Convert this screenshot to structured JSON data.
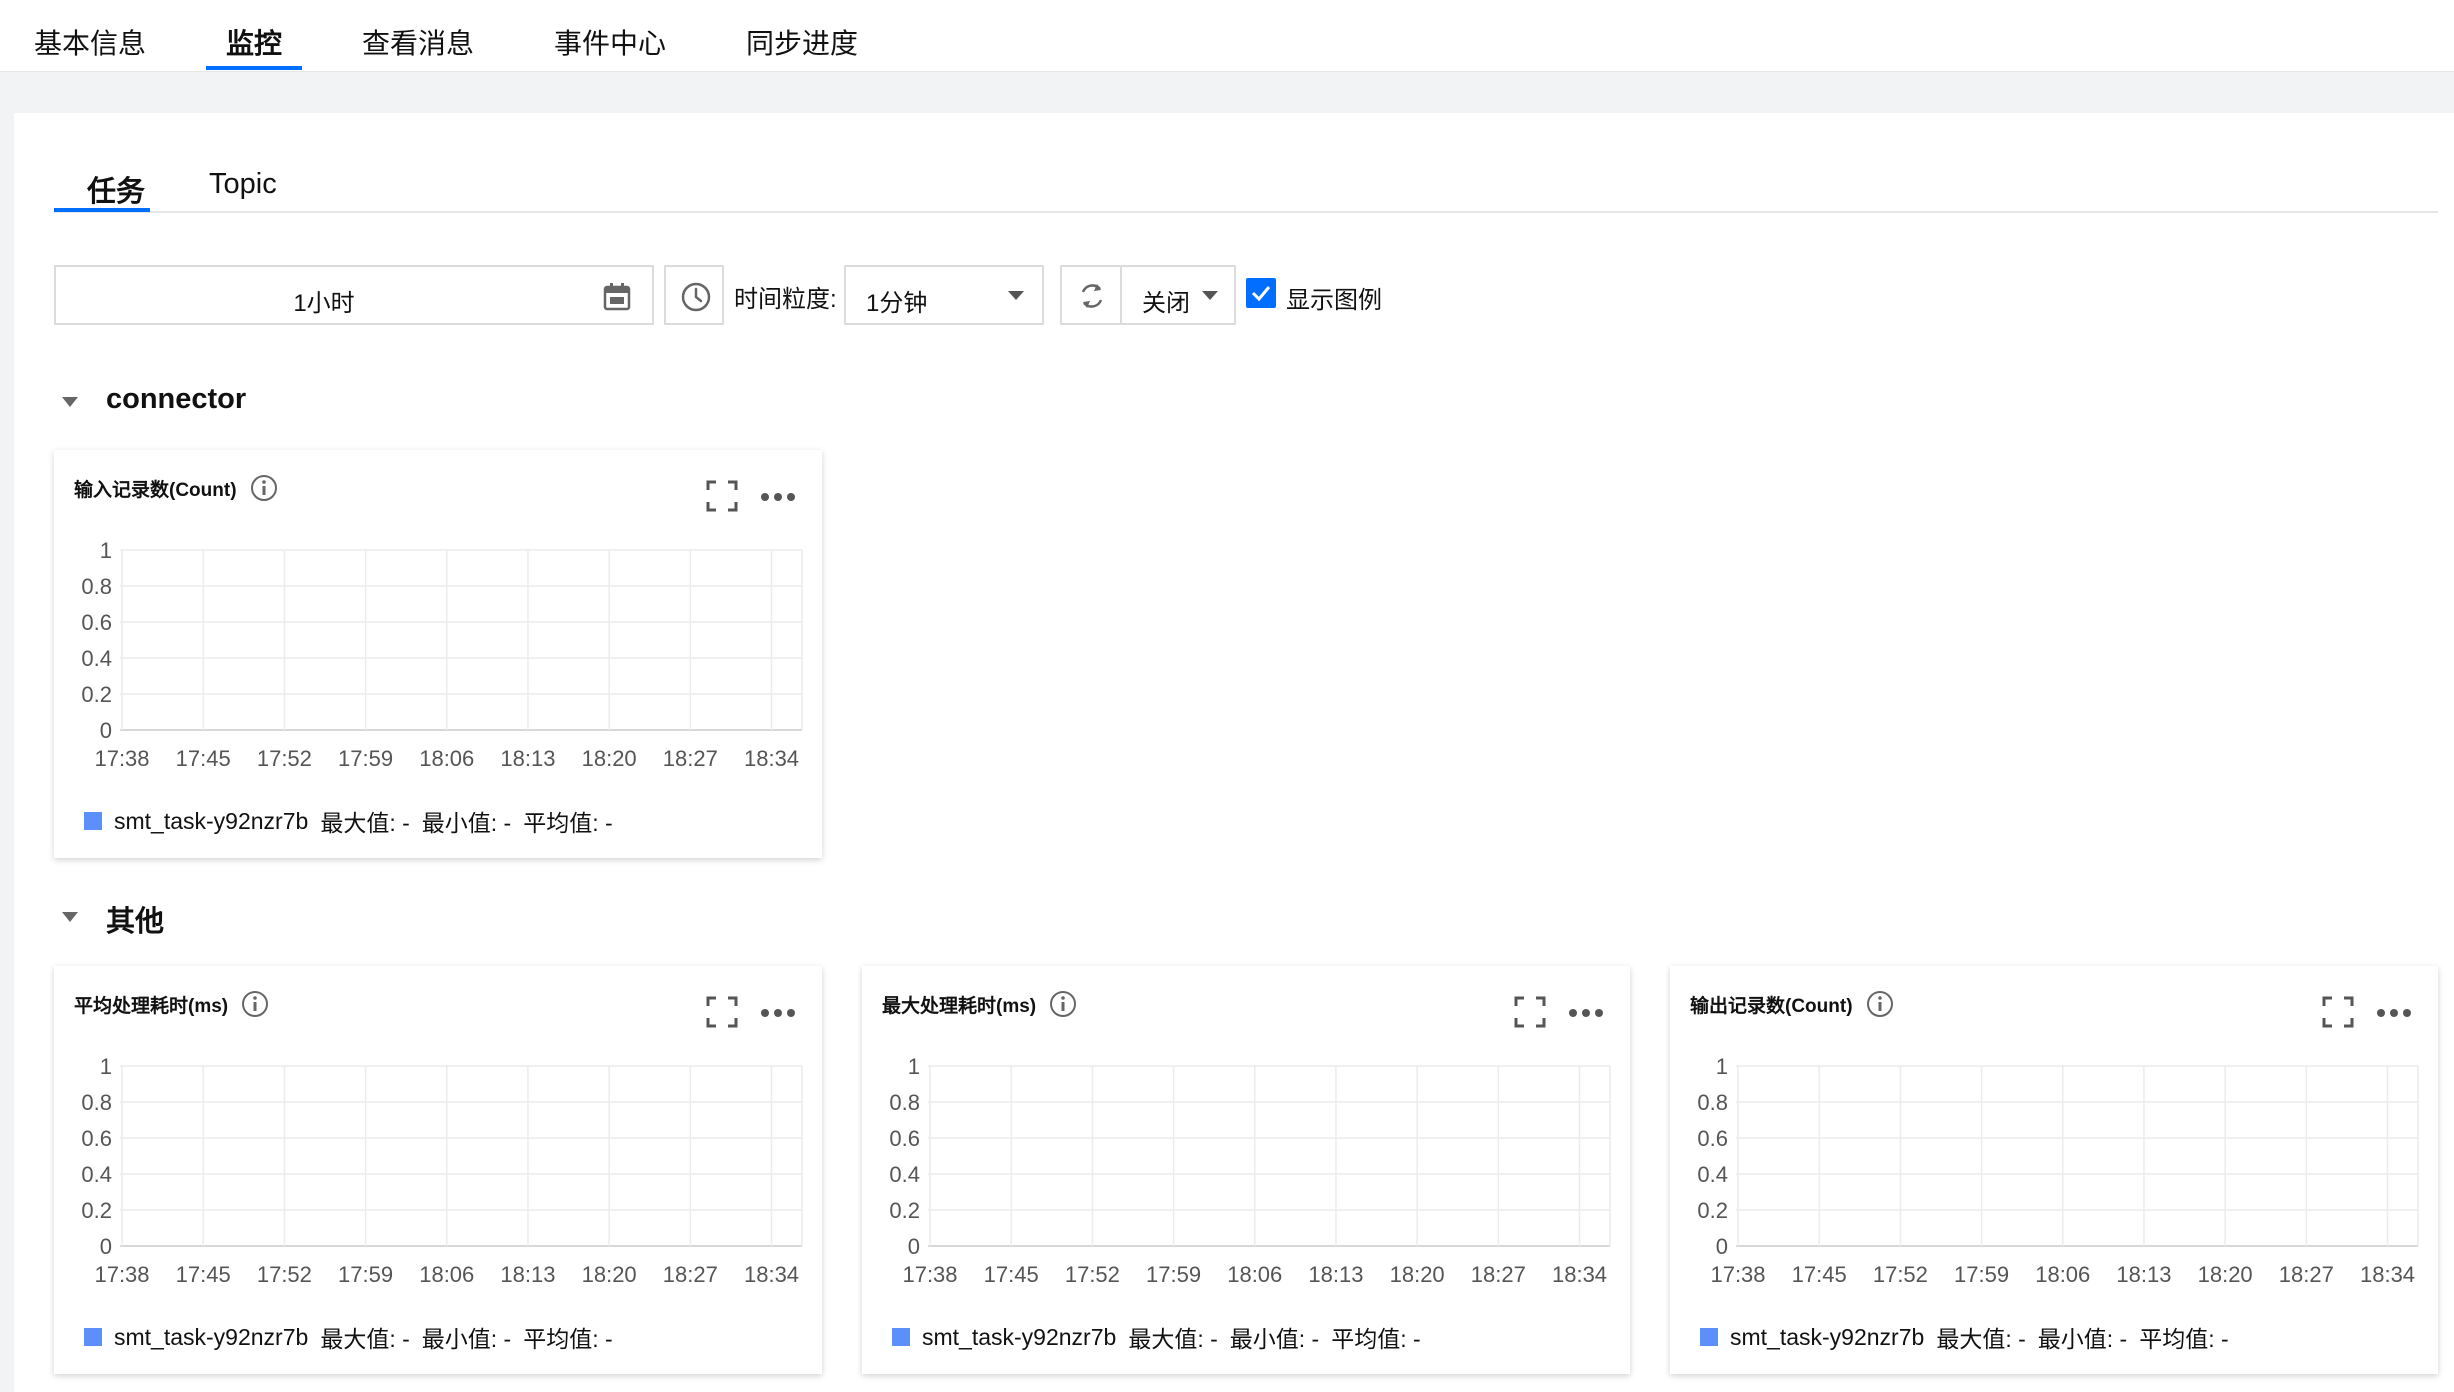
{
  "top_tabs": [
    {
      "label": "基本信息",
      "active": false
    },
    {
      "label": "监控",
      "active": true
    },
    {
      "label": "查看消息",
      "active": false
    },
    {
      "label": "事件中心",
      "active": false
    },
    {
      "label": "同步进度",
      "active": false
    }
  ],
  "sub_tabs": [
    {
      "label": "任务",
      "active": true
    },
    {
      "label": "Topic",
      "active": false
    }
  ],
  "toolbar": {
    "time_range": "1小时",
    "granularity_label": "时间粒度:",
    "granularity_value": "1分钟",
    "refresh_value": "关闭",
    "show_legend_label": "显示图例",
    "show_legend_checked": true
  },
  "sections": [
    {
      "title": "connector"
    },
    {
      "title": "其他"
    }
  ],
  "charts": [
    {
      "title": "输入记录数(Count)"
    },
    {
      "title": "平均处理耗时(ms)"
    },
    {
      "title": "最大处理耗时(ms)"
    },
    {
      "title": "输出记录数(Count)"
    }
  ],
  "legend": {
    "series_name": "smt_task-y92nzr7b",
    "max": "最大值: -",
    "min": "最小值: -",
    "avg": "平均值: -"
  },
  "chart_data": [
    {
      "type": "line",
      "title": "输入记录数(Count)",
      "x": [
        "17:38",
        "17:45",
        "17:52",
        "17:59",
        "18:06",
        "18:13",
        "18:20",
        "18:27",
        "18:34"
      ],
      "yticks": [
        "1",
        "0.8",
        "0.6",
        "0.4",
        "0.2",
        "0"
      ],
      "ylim": [
        0,
        1
      ],
      "series": [
        {
          "name": "smt_task-y92nzr7b",
          "values": []
        }
      ],
      "grid": true,
      "legend": "bottom-left",
      "colors": {
        "series": "#5b8ff9"
      }
    },
    {
      "type": "line",
      "title": "平均处理耗时(ms)",
      "x": [
        "17:38",
        "17:45",
        "17:52",
        "17:59",
        "18:06",
        "18:13",
        "18:20",
        "18:27",
        "18:34"
      ],
      "yticks": [
        "1",
        "0.8",
        "0.6",
        "0.4",
        "0.2",
        "0"
      ],
      "ylim": [
        0,
        1
      ],
      "series": [
        {
          "name": "smt_task-y92nzr7b",
          "values": []
        }
      ],
      "grid": true,
      "legend": "bottom-left",
      "colors": {
        "series": "#5b8ff9"
      }
    },
    {
      "type": "line",
      "title": "最大处理耗时(ms)",
      "x": [
        "17:38",
        "17:45",
        "17:52",
        "17:59",
        "18:06",
        "18:13",
        "18:20",
        "18:27",
        "18:34"
      ],
      "yticks": [
        "1",
        "0.8",
        "0.6",
        "0.4",
        "0.2",
        "0"
      ],
      "ylim": [
        0,
        1
      ],
      "series": [
        {
          "name": "smt_task-y92nzr7b",
          "values": []
        }
      ],
      "grid": true,
      "legend": "bottom-left",
      "colors": {
        "series": "#5b8ff9"
      }
    },
    {
      "type": "line",
      "title": "输出记录数(Count)",
      "x": [
        "17:38",
        "17:45",
        "17:52",
        "17:59",
        "18:06",
        "18:13",
        "18:20",
        "18:27",
        "18:34"
      ],
      "yticks": [
        "1",
        "0.8",
        "0.6",
        "0.4",
        "0.2",
        "0"
      ],
      "ylim": [
        0,
        1
      ],
      "series": [
        {
          "name": "smt_task-y92nzr7b",
          "values": []
        }
      ],
      "grid": true,
      "legend": "bottom-left",
      "colors": {
        "series": "#5b8ff9"
      }
    }
  ]
}
